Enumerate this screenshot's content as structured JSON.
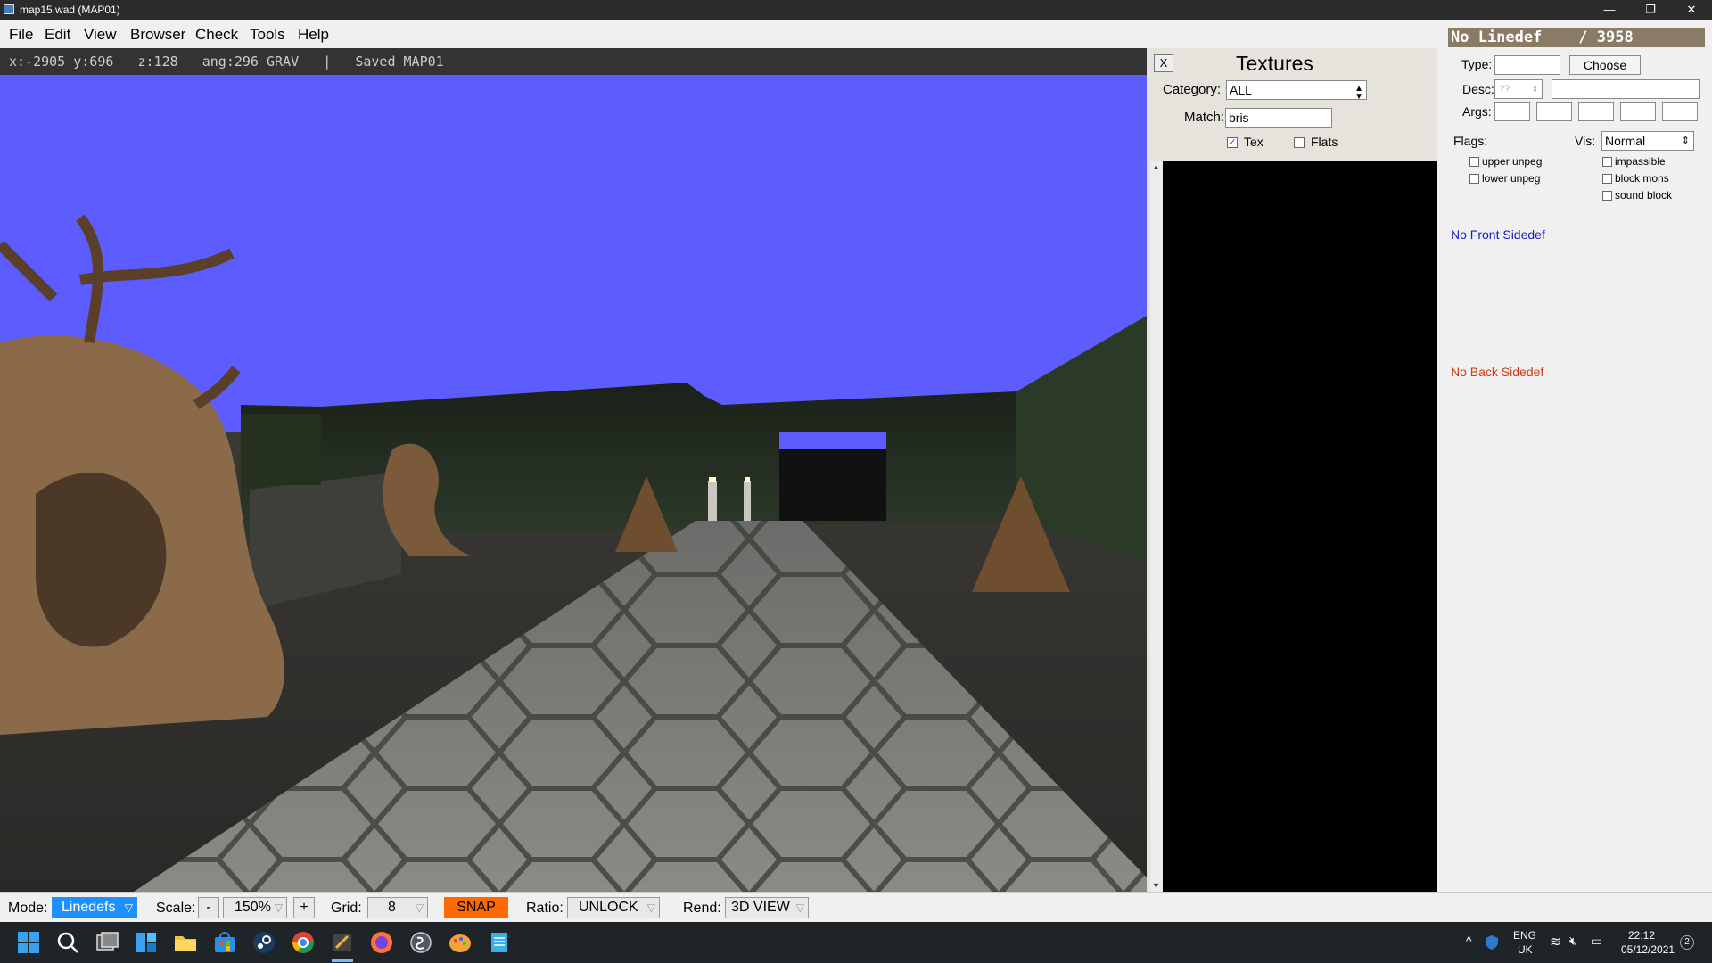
{
  "window": {
    "title": "map15.wad (MAP01)",
    "minimize_glyph": "—",
    "restore_glyph": "❐",
    "close_glyph": "✕"
  },
  "menu": [
    "File",
    "Edit",
    "View",
    "Browser",
    "Check",
    "Tools",
    "Help"
  ],
  "status": {
    "text": "x:-2905 y:696   z:128   ang:296 GRAV   |   Saved MAP01"
  },
  "textures_panel": {
    "close_label": "X",
    "title": "Textures",
    "category_label": "Category:",
    "category_value": "ALL",
    "match_label": "Match:",
    "match_value": "bris",
    "tex_label": "Tex",
    "tex_checked": true,
    "flats_label": "Flats",
    "flats_checked": false
  },
  "linedef_panel": {
    "header": "No Linedef    / 3958",
    "type_label": "Type:",
    "type_value": "",
    "choose_label": "Choose",
    "desc_label": "Desc:",
    "desc_spinner": "??",
    "args_label": "Args:",
    "flags_label": "Flags:",
    "vis_label": "Vis:",
    "vis_value": "Normal",
    "flags_left": [
      "upper unpeg",
      "lower unpeg"
    ],
    "flags_right": [
      "impassible",
      "block mons",
      "sound block"
    ],
    "front_sidedef": "No Front Sidedef",
    "back_sidedef": "No Back Sidedef",
    "front_color": "#1a1ad0",
    "back_color": "#d03a10",
    "header_color": "#8a7b67"
  },
  "bottom_bar": {
    "mode_label": "Mode:",
    "mode_value": "Linedefs",
    "scale_label": "Scale:",
    "scale_minus": "-",
    "scale_value": "150%",
    "scale_plus": "+",
    "grid_label": "Grid:",
    "grid_value": "8",
    "snap_label": "SNAP",
    "ratio_label": "Ratio:",
    "ratio_value": "UNLOCK",
    "rend_label": "Rend:",
    "rend_value": "3D VIEW",
    "mode_color": "#1e90ff",
    "snap_color": "#ff6a00"
  },
  "taskbar": {
    "icons": [
      "start-icon",
      "search-icon",
      "task-view-icon",
      "widgets-icon",
      "file-explorer-icon",
      "store-icon",
      "steam-icon",
      "chrome-icon",
      "eureka-icon",
      "firefox-icon",
      "app-icon",
      "paint-icon",
      "notepad-icon"
    ],
    "lang_top": "ENG",
    "lang_bottom": "UK",
    "time": "22:12",
    "date": "05/12/2021",
    "notif_count": "2"
  }
}
